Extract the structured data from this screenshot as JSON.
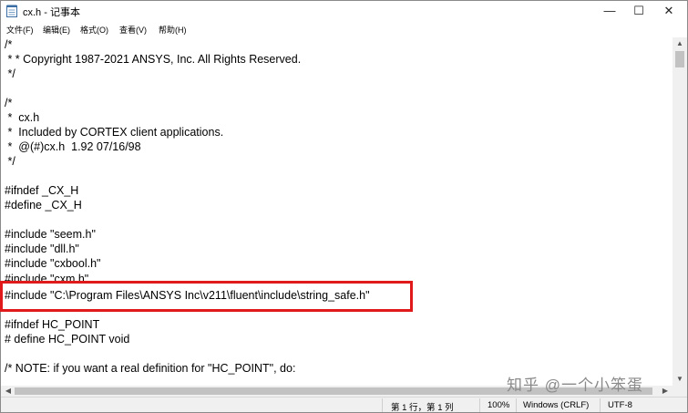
{
  "window": {
    "title": "cx.h - 记事本",
    "minimize": "—",
    "maximize": "☐",
    "close": "✕"
  },
  "menu": {
    "file": "文件(F)",
    "edit": "编辑(E)",
    "format": "格式(O)",
    "view": "查看(V)",
    "help": "帮助(H)"
  },
  "editor": {
    "lines": [
      "/*",
      " * * Copyright 1987-2021 ANSYS, Inc. All Rights Reserved.",
      " */",
      "",
      "/*",
      " *  cx.h",
      " *  Included by CORTEX client applications.",
      " *  @(#)cx.h  1.92 07/16/98",
      " */",
      "",
      "#ifndef _CX_H",
      "#define _CX_H",
      "",
      "#include \"seem.h\"",
      "#include \"dll.h\"",
      "#include \"cxbool.h\"",
      "#include \"cxm.h\"",
      "#include \"C:\\Program Files\\ANSYS Inc\\v211\\fluent\\include\\string_safe.h\"",
      "",
      "#ifndef HC_POINT",
      "# define HC_POINT void",
      "",
      "/* NOTE: if you want a real definition for \"HC_POINT\", do:"
    ]
  },
  "status": {
    "position": "第 1 行，第 1 列",
    "zoom": "100%",
    "eol": "Windows (CRLF)",
    "encoding": "UTF-8"
  },
  "watermark": "知乎 @一个小笨蛋"
}
